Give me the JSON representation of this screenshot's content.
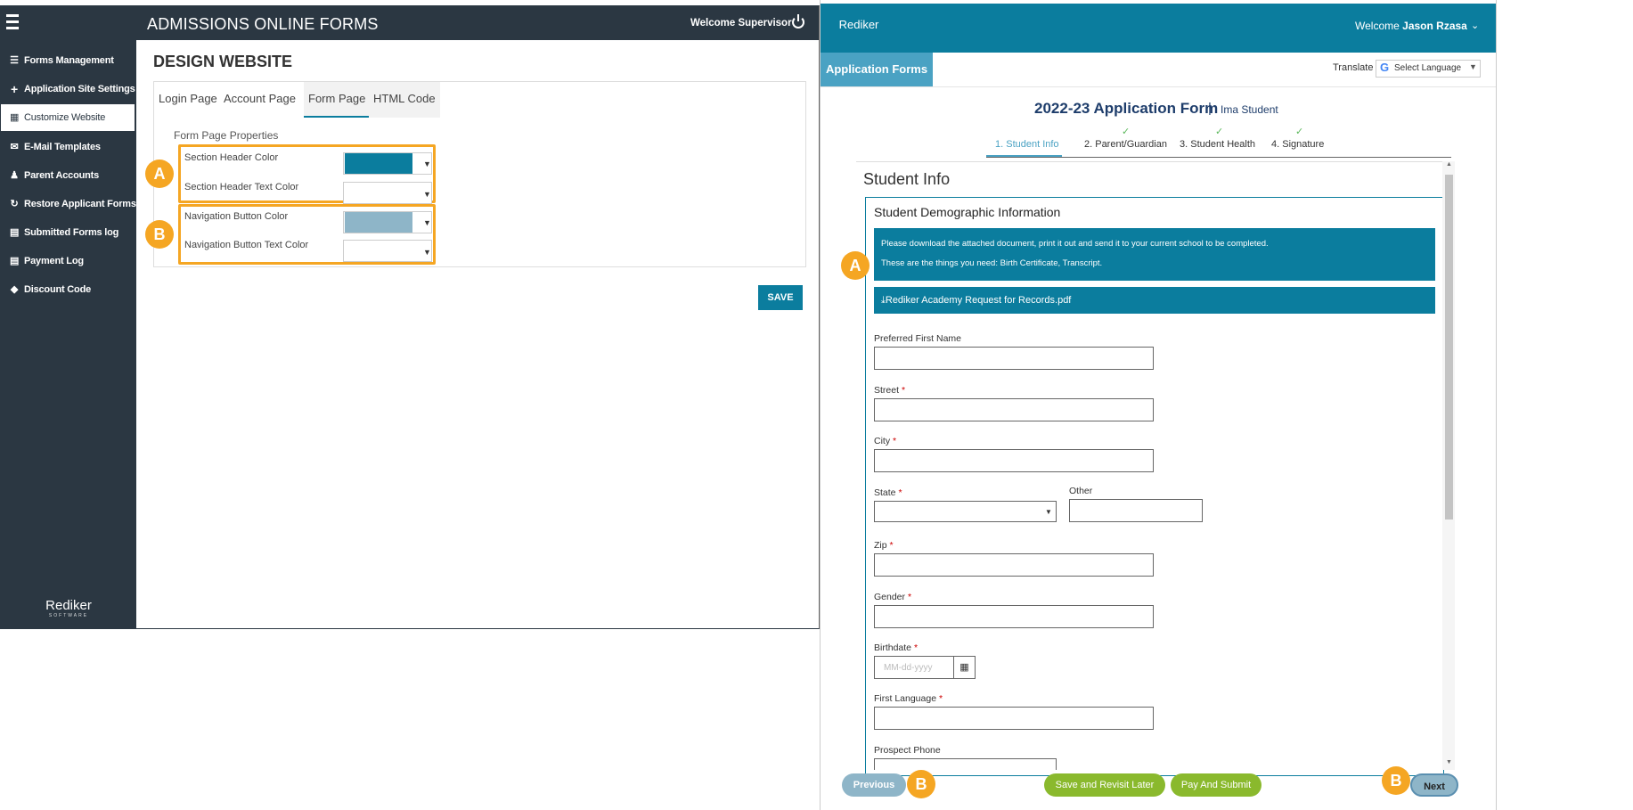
{
  "admin": {
    "title": "ADMISSIONS ONLINE FORMS",
    "welcome": "Welcome Supervisor",
    "page_heading": "DESIGN WEBSITE",
    "sidebar": [
      {
        "label": "Forms Management",
        "icon": "list-icon"
      },
      {
        "label": "Application Site Settings",
        "icon": "plus-icon"
      },
      {
        "label": "Customize Website",
        "icon": "grid-icon"
      },
      {
        "label": "E-Mail Templates",
        "icon": "envelope-icon"
      },
      {
        "label": "Parent Accounts",
        "icon": "users-icon"
      },
      {
        "label": "Restore Applicant Forms",
        "icon": "refresh-icon"
      },
      {
        "label": "Submitted Forms log",
        "icon": "document-icon"
      },
      {
        "label": "Payment Log",
        "icon": "document-icon"
      },
      {
        "label": "Discount Code",
        "icon": "tag-icon"
      }
    ],
    "logo": "Rediker",
    "logo_sub": "SOFTWARE",
    "tabs": [
      "Login Page",
      "Account Page",
      "Form Page",
      "HTML Code"
    ],
    "active_tab": "Form Page",
    "section_title": "Form Page Properties",
    "properties": [
      {
        "label": "Section Header Color",
        "color": "#0b7d9e"
      },
      {
        "label": "Section Header Text Color",
        "color": "#ffffff"
      },
      {
        "label": "Navigation Button Color",
        "color": "#8eb5c8"
      },
      {
        "label": "Navigation Button Text Color",
        "color": "#ffffff"
      }
    ],
    "badges": [
      "A",
      "B"
    ],
    "save_label": "SAVE"
  },
  "app": {
    "logo": "Rediker",
    "welcome_prefix": "Welcome",
    "welcome_name": "Jason Rzasa",
    "tab_label": "Application Forms",
    "translate_label": "Translate",
    "language_select": "Select Language",
    "form_title": "2022-23 Application Form",
    "separator": "|",
    "student_name": "Ima Student",
    "steps": [
      "1. Student Info",
      "2. Parent/Guardian",
      "3. Student Health",
      "4. Signature"
    ],
    "section_title": "Student Info",
    "subsection_title": "Student Demographic Information",
    "info_line1": "Please download the attached document, print it out and send it to your current school to be completed.",
    "info_line2": "These are the things you need: Birth Certificate, Transcript.",
    "download_label": "Rediker Academy Request for Records.pdf",
    "fields": {
      "preferred_first_name": "Preferred First Name",
      "street": "Street",
      "city": "City",
      "state": "State",
      "other": "Other",
      "zip": "Zip",
      "gender": "Gender",
      "birthdate": "Birthdate",
      "birthdate_placeholder": "MM-dd-yyyy",
      "first_language": "First Language",
      "prospect_phone": "Prospect Phone"
    },
    "required_mark": "*",
    "buttons": {
      "previous": "Previous",
      "save_later": "Save and Revisit Later",
      "pay_submit": "Pay And Submit",
      "next": "Next"
    },
    "badges": [
      "A",
      "B",
      "B"
    ]
  },
  "colors": {
    "sidebar": "#2b3742",
    "header_teal": "#0b7d9e",
    "accent_orange": "#f5a623",
    "nav_button": "#8eb5c8",
    "green_button": "#8ab92d"
  }
}
